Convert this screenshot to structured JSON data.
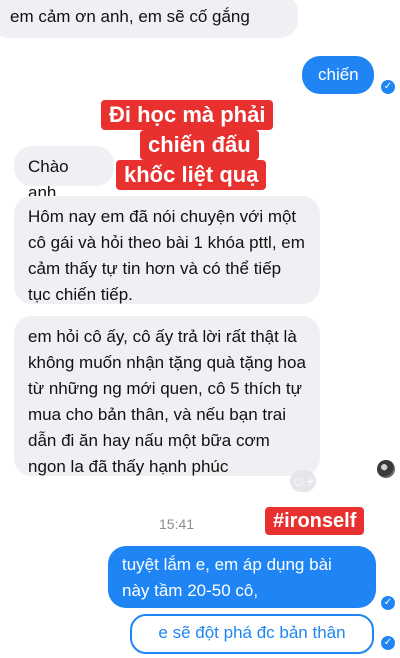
{
  "messages": {
    "m1": "em cảm ơn anh, em sẽ cố gắng",
    "m2": "chiến",
    "m3": "Chào anh",
    "m4": "Hôm nay em đã nói chuyện với một cô gái và hỏi theo bài 1 khóa pttl, em cảm thấy tự tin hơn và có thể tiếp tục chiến tiếp.",
    "m5": "em hỏi cô ấy, cô ấy trả lời rất thật là không muốn nhận tặng quà tặng hoa từ những ng mới quen, cô 5 thích tự mua cho bản thân, và nếu bạn trai dẫn đi ăn hay nấu một bữa cơm ngon la đã thấy hạnh phúc",
    "m6": "tuyệt lắm e, em áp dụng bài này tầm 20-50 cô,",
    "m7": "e sẽ đột phá đc bản thân"
  },
  "overlay": {
    "line1": "Đi học mà phải",
    "line2": "chiến đấu",
    "line3": "khốc liệt quạ",
    "hashtag": "#ironself"
  },
  "timestamp": "15:41",
  "icons": {
    "check": "✓",
    "react": "☺+"
  },
  "colors": {
    "outgoing": "#1f85f5",
    "incoming": "#eef0f3",
    "overlay": "#e8302f"
  }
}
